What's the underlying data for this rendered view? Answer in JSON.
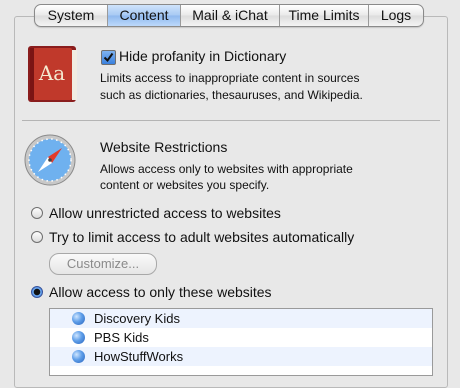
{
  "tabs": [
    {
      "label": "System",
      "active": false
    },
    {
      "label": "Content",
      "active": true
    },
    {
      "label": "Mail & iChat",
      "active": false
    },
    {
      "label": "Time Limits",
      "active": false
    },
    {
      "label": "Logs",
      "active": false
    }
  ],
  "dictionary_icon": {
    "glyph": "Aa",
    "name": "dictionary-icon"
  },
  "profanity": {
    "label": "Hide profanity in Dictionary",
    "checked": true,
    "description_line1": "Limits access to inappropriate content in sources",
    "description_line2": "such as dictionaries, thesauruses, and Wikipedia."
  },
  "website": {
    "title": "Website Restrictions",
    "description_line1": "Allows access only to websites with appropriate",
    "description_line2": "content or websites you specify.",
    "options": [
      {
        "label": "Allow unrestricted access to websites",
        "selected": false
      },
      {
        "label": "Try to limit access to adult websites automatically",
        "selected": false
      },
      {
        "label": "Allow access to only these websites",
        "selected": true
      }
    ],
    "customize_label": "Customize...",
    "sites": [
      "Discovery Kids",
      "PBS Kids",
      "HowStuffWorks"
    ]
  },
  "colors": {
    "accent": "#3a80de",
    "list_alt": "#edf3fe"
  }
}
